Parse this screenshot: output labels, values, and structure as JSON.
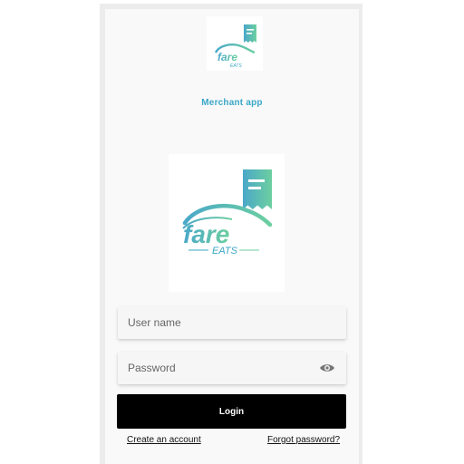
{
  "header": {
    "logo_small": "fare-eats-logo",
    "subtitle": "Merchant app"
  },
  "hero": {
    "logo_large": "fare-eats-logo"
  },
  "form": {
    "username_placeholder": "User name",
    "password_placeholder": "Password",
    "password_toggle_icon": "eye-icon",
    "login_label": "Login",
    "create_account_label": "Create an account",
    "forgot_password_label": "Forgot password?"
  },
  "colors": {
    "brand_teal": "#5cc7b0",
    "brand_blue": "#3aa7c7",
    "button_bg": "#000000"
  }
}
